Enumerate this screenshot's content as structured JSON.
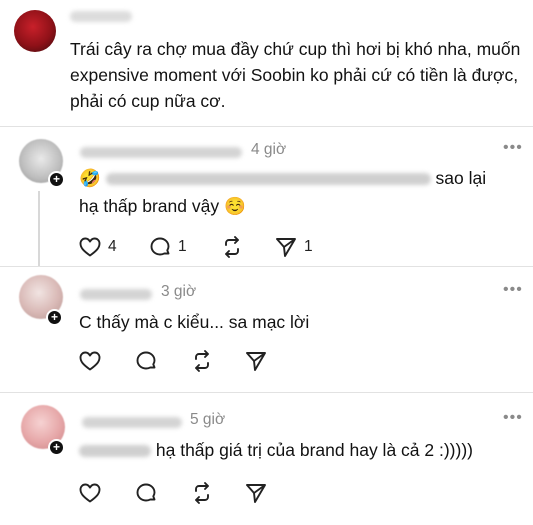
{
  "top_post": {
    "text": "Trái cây ra chợ mua đầy chứ cup thì hơi bị khó nha, muốn expensive moment với Soobin ko phải cứ có tiền là được, phải có cup nữa cơ."
  },
  "comments": [
    {
      "time": "4 giờ",
      "emoji": "🤣",
      "text_visible": "sao lại",
      "text_line2": "hạ thấp brand vậy ☺️",
      "likes": "4",
      "replies": "1",
      "shares": "1"
    },
    {
      "time": "3 giờ",
      "text": "C thấy mà c kiểu... sa mạc lời"
    },
    {
      "time": "5 giờ",
      "text_visible": "hạ thấp giá trị của brand hay là cả 2 :)))))"
    }
  ],
  "icons": {
    "more": "more-icon",
    "like": "heart-icon",
    "reply": "comment-icon",
    "repost": "repost-icon",
    "share": "send-icon"
  }
}
